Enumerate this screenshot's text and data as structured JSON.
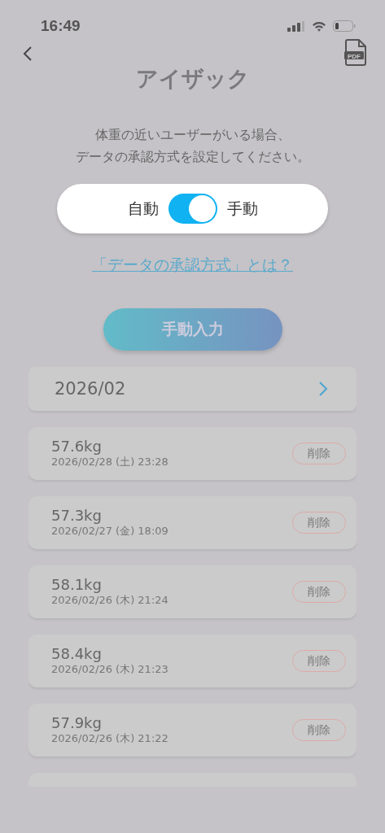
{
  "status_bar": {
    "time": "16:49"
  },
  "header": {
    "title": "アイザック",
    "pdf_label": "PDF"
  },
  "description": [
    "体重の近いユーザーがいる場合、",
    "データの承認方式を設定してください。"
  ],
  "approval_toggle": {
    "left_label": "自動",
    "right_label": "手動",
    "on": true
  },
  "help_link": "「データの承認方式」とは？",
  "manual_entry_button": "手動入力",
  "month": {
    "label": "2026/02"
  },
  "entries": [
    {
      "weight": "57.6kg",
      "datetime": "2026/02/28 (土) 23:28",
      "action": "削除"
    },
    {
      "weight": "57.3kg",
      "datetime": "2026/02/27 (金) 18:09",
      "action": "削除"
    },
    {
      "weight": "58.1kg",
      "datetime": "2026/02/26 (木) 21:24",
      "action": "削除"
    },
    {
      "weight": "58.4kg",
      "datetime": "2026/02/26 (木) 21:23",
      "action": "削除"
    },
    {
      "weight": "57.9kg",
      "datetime": "2026/02/26 (木) 21:22",
      "action": "削除"
    }
  ]
}
